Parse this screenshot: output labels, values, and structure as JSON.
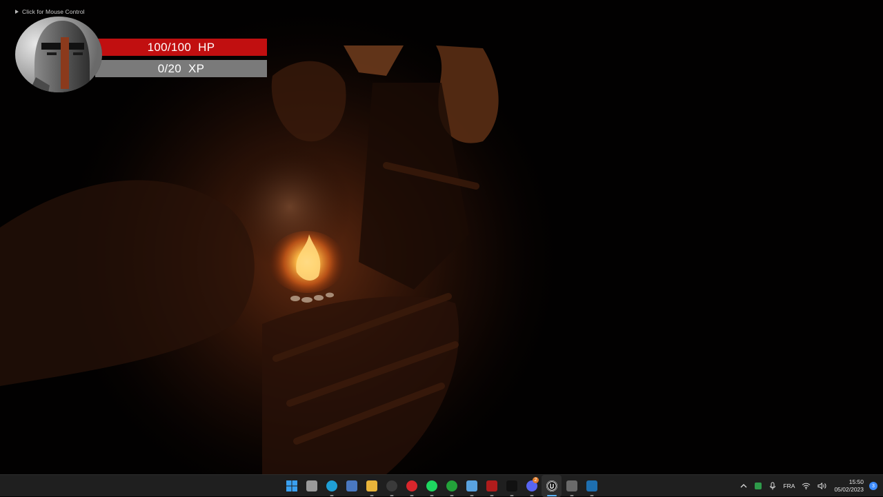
{
  "overlay": {
    "mouse_hint": "Click for Mouse Control"
  },
  "hud": {
    "hp_label": "100/100  HP",
    "hp_fraction": 1.0,
    "xp_label": "0/20  XP",
    "xp_fraction": 0.0,
    "colors": {
      "hp": "#c10f10",
      "xp": "#7a7a7a"
    },
    "portrait_icon": "knight-helmet-portrait"
  },
  "taskbar": {
    "apps": [
      {
        "name": "start",
        "icon": "windows-start-icon",
        "color": "#3aa0f0",
        "glyph": ""
      },
      {
        "name": "task-view",
        "icon": "task-view-icon",
        "color": "#9a9a9a",
        "glyph": ""
      },
      {
        "name": "edge",
        "icon": "edge-icon",
        "color": "#1f9fd6",
        "glyph": ""
      },
      {
        "name": "widgets",
        "icon": "widgets-icon",
        "color": "#4a78c0",
        "glyph": ""
      },
      {
        "name": "file-explorer",
        "icon": "folder-icon",
        "color": "#e8b43a",
        "glyph": ""
      },
      {
        "name": "obs",
        "icon": "obs-icon",
        "color": "#3a3a3a",
        "glyph": ""
      },
      {
        "name": "opera",
        "icon": "opera-icon",
        "color": "#d9262c",
        "glyph": ""
      },
      {
        "name": "spotify",
        "icon": "spotify-icon",
        "color": "#1ed760",
        "glyph": ""
      },
      {
        "name": "xbox",
        "icon": "xbox-icon",
        "color": "#23a23a",
        "glyph": ""
      },
      {
        "name": "photos",
        "icon": "photos-icon",
        "color": "#5aa3e0",
        "glyph": ""
      },
      {
        "name": "game-app",
        "icon": "game-app-icon",
        "color": "#b01c1c",
        "glyph": ""
      },
      {
        "name": "tiktok",
        "icon": "tiktok-icon",
        "color": "#111111",
        "glyph": ""
      },
      {
        "name": "discord",
        "icon": "discord-icon",
        "color": "#5865f2",
        "glyph": "",
        "badge": "2"
      },
      {
        "name": "unreal",
        "icon": "unreal-engine-icon",
        "color": "#f2f2f2",
        "glyph": "",
        "active": true
      },
      {
        "name": "tool-app",
        "icon": "tool-app-icon",
        "color": "#6a6a6a",
        "glyph": ""
      },
      {
        "name": "app-blue",
        "icon": "blue-app-icon",
        "color": "#1e6fb0",
        "glyph": ""
      }
    ],
    "tray": {
      "language": "FRA",
      "time": "15:50",
      "date": "05/02/2023",
      "notification_count": "3"
    }
  }
}
